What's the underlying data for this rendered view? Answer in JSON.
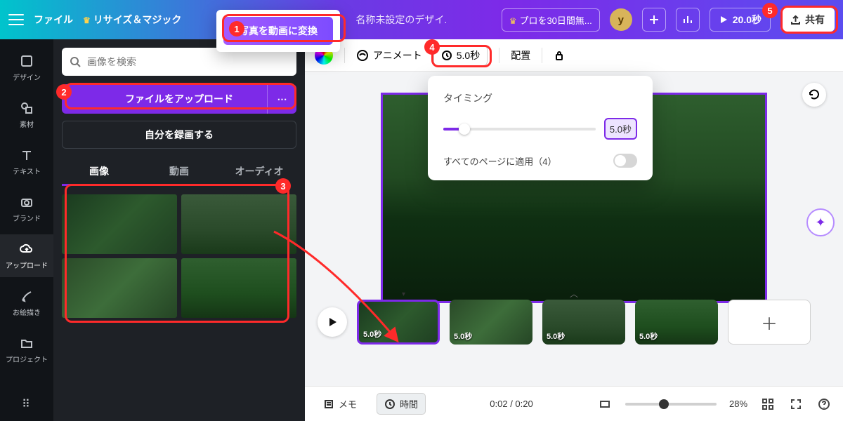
{
  "topbar": {
    "file_label": "ファイル",
    "resize_label": "リサイズ＆マジック",
    "convert_label": "写真を動画に変換",
    "docname_placeholder": "名称未設定のデザイ...",
    "trial_label": "プロを30日間無...",
    "avatar_letter": "y",
    "play_duration": "20.0秒",
    "share_label": "共有"
  },
  "leftrail": {
    "items": [
      {
        "label": "デザイン"
      },
      {
        "label": "素材"
      },
      {
        "label": "テキスト"
      },
      {
        "label": "ブランド"
      },
      {
        "label": "アップロード"
      },
      {
        "label": "お絵描き"
      },
      {
        "label": "プロジェクト"
      }
    ]
  },
  "leftpanel": {
    "search_placeholder": "画像を検索",
    "upload_label": "ファイルをアップロード",
    "record_label": "自分を録画する",
    "tabs": [
      "画像",
      "動画",
      "オーディオ"
    ],
    "active_tab": 0
  },
  "contextbar": {
    "animate_label": "アニメート",
    "duration_label": "5.0秒",
    "position_label": "配置"
  },
  "timing_popover": {
    "title": "タイミング",
    "value_label": "5.0秒",
    "apply_all_label": "すべてのページに適用（4）"
  },
  "timeline": {
    "clips": [
      {
        "label": "5.0秒"
      },
      {
        "label": "5.0秒"
      },
      {
        "label": "5.0秒"
      },
      {
        "label": "5.0秒"
      }
    ]
  },
  "bottombar": {
    "memo_label": "メモ",
    "time_label": "時間",
    "timecode": "0:02 / 0:20",
    "zoom_label": "28%"
  },
  "annotations": {
    "badges": [
      "1",
      "2",
      "3",
      "4",
      "5"
    ]
  }
}
